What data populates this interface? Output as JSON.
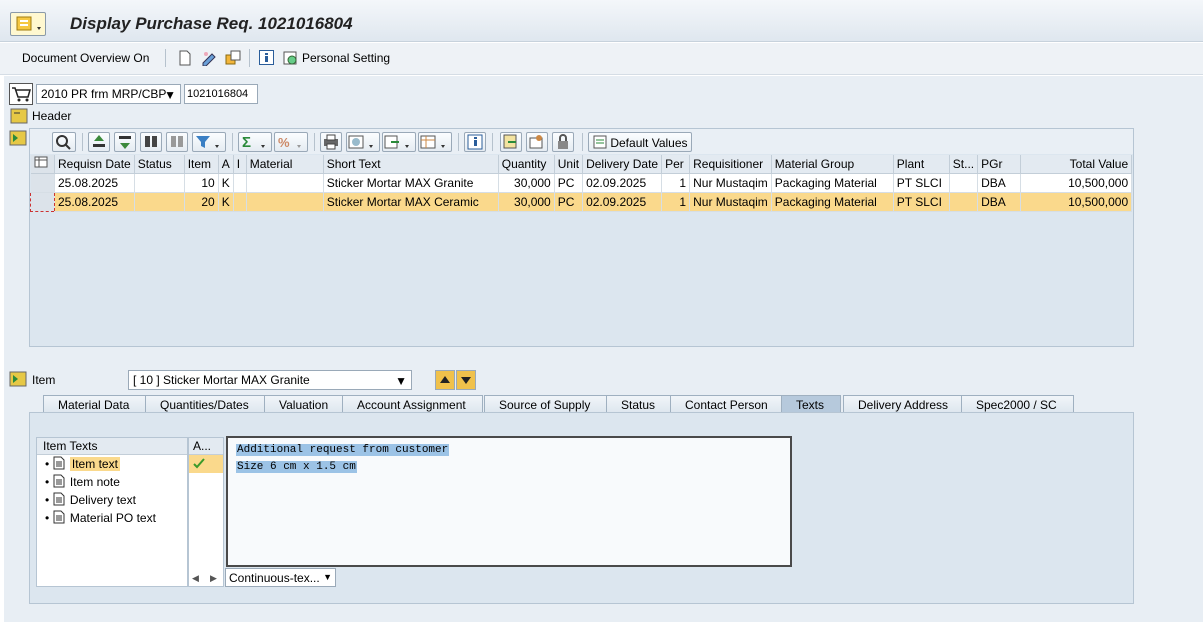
{
  "window": {
    "title": "Display Purchase Req. 1021016804"
  },
  "toolbar": {
    "doc_overview": "Document Overview On",
    "personal_setting": "Personal Setting"
  },
  "document": {
    "type": "2010 PR frm MRP/CBP",
    "number": "1021016804"
  },
  "header": {
    "label": "Header"
  },
  "grid_toolbar": {
    "default_values": "Default Values"
  },
  "grid": {
    "columns": [
      "Requisn Date",
      "Status",
      "Item",
      "A",
      "I",
      "Material",
      "Short Text",
      "Quantity",
      "Unit",
      "Delivery Date",
      "Per",
      "Requisitioner",
      "Material Group",
      "Plant",
      "St...",
      "PGr",
      "Total Value"
    ],
    "rows": [
      [
        "25.08.2025",
        "",
        "10",
        "K",
        "",
        "",
        "Sticker Mortar MAX Granite",
        "30,000",
        "PC",
        "02.09.2025",
        "1",
        "Nur Mustaqim",
        "Packaging Material",
        "PT SLCI",
        "",
        "DBA",
        "10,500,000"
      ],
      [
        "25.08.2025",
        "",
        "20",
        "K",
        "",
        "",
        "Sticker Mortar MAX Ceramic",
        "30,000",
        "PC",
        "02.09.2025",
        "1",
        "Nur Mustaqim",
        "Packaging Material",
        "PT SLCI",
        "",
        "DBA",
        "10,500,000"
      ]
    ]
  },
  "item": {
    "label": "Item",
    "selected": "[ 10 ] Sticker Mortar MAX Granite"
  },
  "tabs": [
    "Material Data",
    "Quantities/Dates",
    "Valuation",
    "Account Assignment",
    "Source of Supply",
    "Status",
    "Contact Person",
    "Texts",
    "Delivery Address",
    "Spec2000 / SC"
  ],
  "texts": {
    "tree_header": "Item Texts",
    "col2_header": "A...",
    "nodes": [
      "Item text",
      "Item note",
      "Delivery text",
      "Material PO text"
    ],
    "lines": [
      "Additional request from customer",
      "Size 6 cm x 1.5 cm"
    ],
    "format": "Continuous-tex..."
  }
}
